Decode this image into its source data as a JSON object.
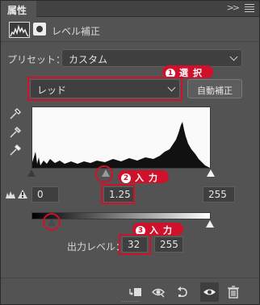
{
  "panel": {
    "tab_label": "属性",
    "collapse_label": ">>",
    "adjustment_title": "レベル補正"
  },
  "preset": {
    "label": "プリセット：",
    "value": "カスタム"
  },
  "channel": {
    "value": "レッド",
    "auto_button": "自動補正"
  },
  "input_levels": {
    "black": "0",
    "gamma": "1.25",
    "white": "255"
  },
  "output_levels": {
    "label": "出力レベル：",
    "black": "32",
    "white": "255"
  },
  "annotations": {
    "step1": {
      "num": "1",
      "text": "選択"
    },
    "step2": {
      "num": "2",
      "text": "入力"
    },
    "step3": {
      "num": "3",
      "text": "入力"
    },
    "color": "#d0112b"
  },
  "icons": {
    "eyedroppers": [
      "black-point-eyedropper-icon",
      "gray-point-eyedropper-icon",
      "white-point-eyedropper-icon"
    ],
    "bottom": [
      "clip-to-layer-icon",
      "view-previous-icon",
      "reset-icon",
      "visibility-eye-icon",
      "trash-icon"
    ]
  }
}
